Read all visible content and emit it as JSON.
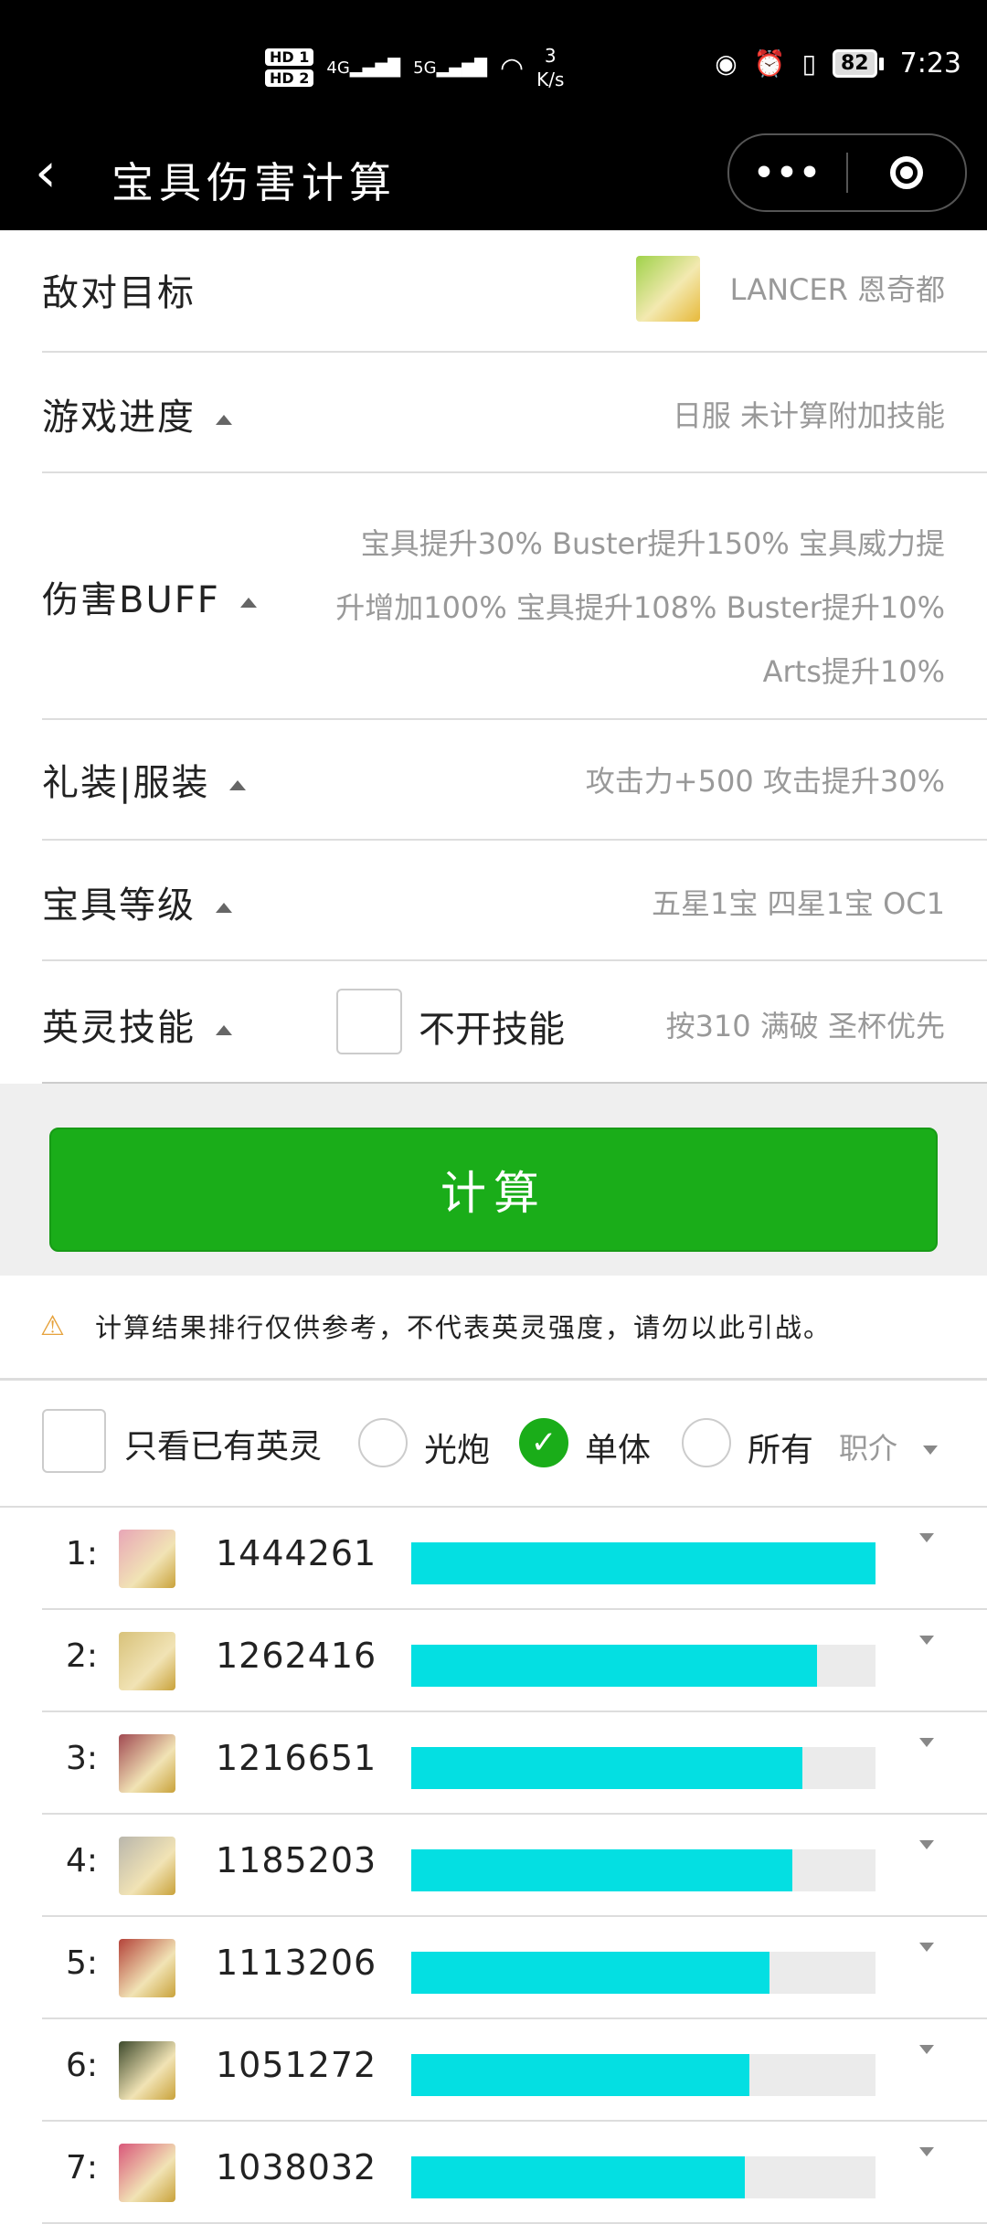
{
  "status_bar": {
    "sim1": "HD 1",
    "sim2": "HD 2",
    "net1": "4G",
    "net2": "5G",
    "speed_value": "3",
    "speed_unit": "K/s",
    "battery": "82",
    "time": "7:23"
  },
  "nav": {
    "title": "宝具伤害计算",
    "more_label": "•••"
  },
  "form": {
    "enemy": {
      "label": "敌对目标",
      "value": "LANCER 恩奇都"
    },
    "progress": {
      "label": "游戏进度",
      "value": "日服 未计算附加技能"
    },
    "buff": {
      "label": "伤害BUFF",
      "lines": [
        "宝具提升30% Buster提升150% 宝具威力提",
        "升增加100% 宝具提升108% Buster提升10%",
        "Arts提升10%"
      ]
    },
    "ce": {
      "label": "礼装|服装",
      "value": "攻击力+500 攻击提升30%"
    },
    "np_level": {
      "label": "宝具等级",
      "value": "五星1宝 四星1宝 OC1"
    },
    "skills": {
      "label": "英灵技能",
      "checkbox_label": "不开技能",
      "value": "按310 满破 圣杯优先"
    }
  },
  "calc_button": "计算",
  "notice": "计算结果排行仅供参考，不代表英灵强度，请勿以此引战。",
  "filters": {
    "owned_only": "只看已有英灵",
    "options": [
      "光炮",
      "单体",
      "所有"
    ],
    "selected": "单体",
    "sort": "职介"
  },
  "results": [
    {
      "rank": "1:",
      "damage": "1444261",
      "fraction": 1.0,
      "color": "#e8a6b7"
    },
    {
      "rank": "2:",
      "damage": "1262416",
      "fraction": 0.874,
      "color": "#d8c27a"
    },
    {
      "rank": "3:",
      "damage": "1216651",
      "fraction": 0.842,
      "color": "#a14a52"
    },
    {
      "rank": "4:",
      "damage": "1185203",
      "fraction": 0.821,
      "color": "#b9b6ac"
    },
    {
      "rank": "5:",
      "damage": "1113206",
      "fraction": 0.771,
      "color": "#b4433a"
    },
    {
      "rank": "6:",
      "damage": "1051272",
      "fraction": 0.728,
      "color": "#3d4a2c"
    },
    {
      "rank": "7:",
      "damage": "1038032",
      "fraction": 0.719,
      "color": "#d9577a"
    }
  ]
}
